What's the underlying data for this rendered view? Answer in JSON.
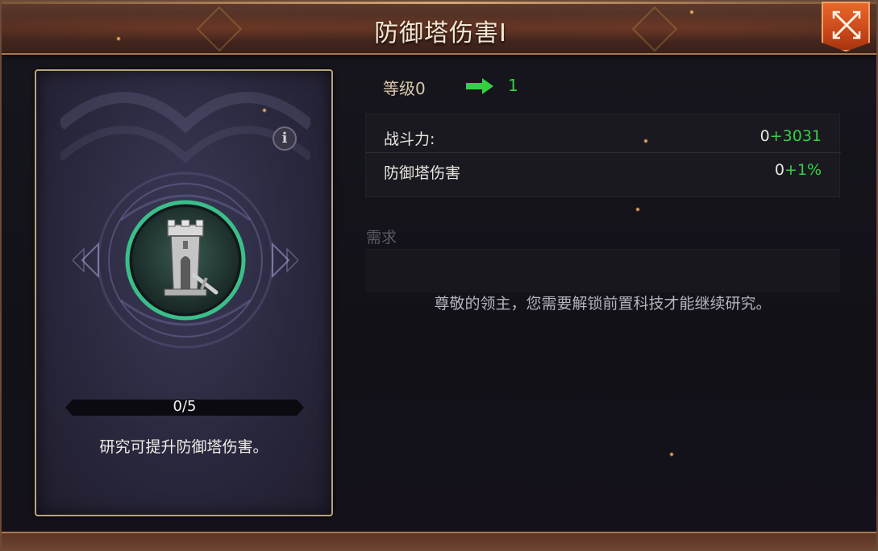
{
  "header": {
    "title": "防御塔伤害I",
    "close_icon": "close-cross-icon"
  },
  "card": {
    "icon": "defense-tower-icon",
    "info_icon_glyph": "i",
    "progress": {
      "text": "0/5",
      "fraction": 0
    },
    "description": "研究可提升防御塔伤害。"
  },
  "level": {
    "current_label": "等级0",
    "arrow_icon": "arrow-right-icon",
    "next": "1"
  },
  "stats": [
    {
      "label": "战斗力:",
      "base": "0",
      "bonus": "+3031"
    },
    {
      "label": "防御塔伤害",
      "base": "0",
      "bonus": "+1%"
    }
  ],
  "requirements": {
    "label": "需求",
    "message": "尊敬的领主，您需要解锁前置科技才能继续研究。"
  },
  "colors": {
    "bonus_green": "#35d042",
    "close_orange": "#e8672a",
    "card_border": "#b9a27d",
    "emblem_ring_green": "#3bbf8a"
  }
}
